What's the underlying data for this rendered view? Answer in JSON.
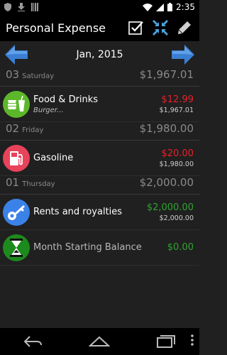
{
  "status_bar": {
    "time": "2:35"
  },
  "action_bar": {
    "title": "Personal Expense"
  },
  "month_nav": {
    "label": "Jan, 2015"
  },
  "days": [
    {
      "num": "03",
      "name": "Saturday",
      "total": "$1,967.01",
      "entries": [
        {
          "name": "Food & Drinks",
          "note": "Burger...",
          "amount": "$12.99",
          "amount_color": "#e8202a",
          "balance": "$1,967.01",
          "icon": "food-drink-icon",
          "icon_bg": "#5cb82a"
        }
      ]
    },
    {
      "num": "02",
      "name": "Friday",
      "total": "$1,980.00",
      "entries": [
        {
          "name": "Gasoline",
          "amount": "$20.00",
          "amount_color": "#e8202a",
          "balance": "$1,980.00",
          "icon": "gas-pump-icon",
          "icon_bg": "#e8435a"
        }
      ]
    },
    {
      "num": "01",
      "name": "Thursday",
      "total": "$2,000.00",
      "entries": [
        {
          "name": "Rents and royalties",
          "amount": "$2,000.00",
          "amount_color": "#2fa42f",
          "balance": "$2,000.00",
          "icon": "key-icon",
          "icon_bg": "#3b82e8"
        }
      ]
    }
  ],
  "starting_balance": {
    "name": "Month Starting Balance",
    "amount": "$0.00",
    "amount_color": "#2fa42f",
    "icon": "hourglass-icon",
    "icon_bg": "#1c8a1c"
  }
}
